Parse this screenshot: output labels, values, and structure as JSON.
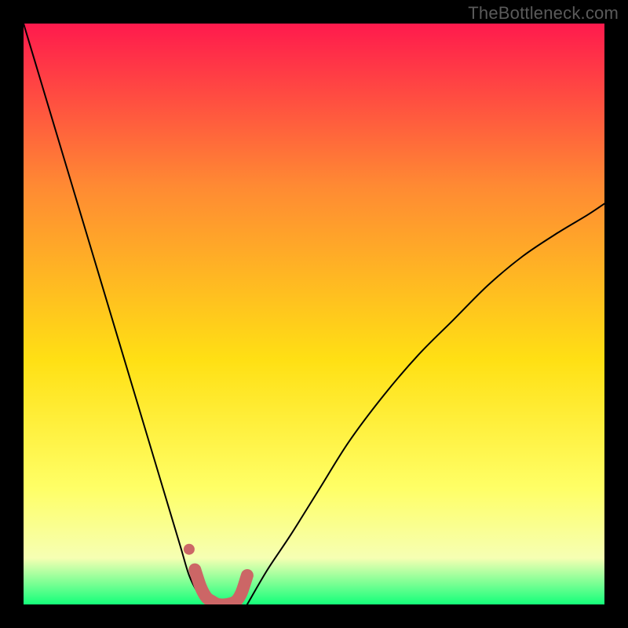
{
  "watermark": "TheBottleneck.com",
  "chart_data": {
    "type": "line",
    "title": "",
    "xlabel": "",
    "ylabel": "",
    "xlim": [
      0,
      1
    ],
    "ylim": [
      0,
      1
    ],
    "background_gradient": {
      "top": "#ff1a4d",
      "mid_upper": "#ff8a33",
      "mid": "#ffe014",
      "mid_lower": "#ffff66",
      "lower": "#f6ffb3",
      "bottom": "#14ff7a"
    },
    "series": [
      {
        "name": "left-curve",
        "color": "#000000",
        "width": 2,
        "x": [
          0.0,
          0.03,
          0.06,
          0.09,
          0.12,
          0.15,
          0.18,
          0.21,
          0.24,
          0.27,
          0.285,
          0.3,
          0.315
        ],
        "values": [
          1.0,
          0.9,
          0.8,
          0.7,
          0.6,
          0.5,
          0.4,
          0.3,
          0.2,
          0.1,
          0.05,
          0.02,
          0.0
        ]
      },
      {
        "name": "right-curve",
        "color": "#000000",
        "width": 2,
        "x": [
          0.385,
          0.42,
          0.46,
          0.51,
          0.56,
          0.62,
          0.68,
          0.74,
          0.8,
          0.86,
          0.92,
          0.97,
          1.0
        ],
        "values": [
          0.0,
          0.06,
          0.12,
          0.2,
          0.28,
          0.36,
          0.43,
          0.49,
          0.55,
          0.6,
          0.64,
          0.67,
          0.69
        ]
      },
      {
        "name": "overlay-trough",
        "color": "#cc6666",
        "width": 16,
        "x": [
          0.295,
          0.305,
          0.315,
          0.325,
          0.335,
          0.35,
          0.365,
          0.375,
          0.385
        ],
        "values": [
          0.06,
          0.03,
          0.012,
          0.005,
          0.0,
          0.0,
          0.005,
          0.02,
          0.05
        ]
      }
    ],
    "marker": {
      "name": "overlay-dot",
      "color": "#cc6666",
      "x": 0.285,
      "y": 0.095,
      "r": 7
    }
  }
}
